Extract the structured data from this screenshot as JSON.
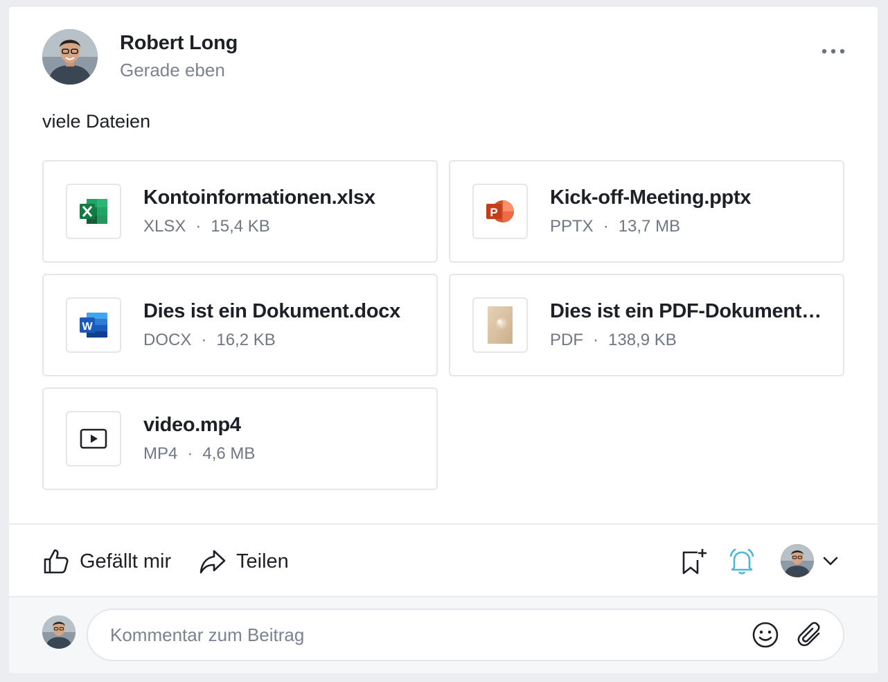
{
  "post": {
    "author": "Robert Long",
    "time": "Gerade eben",
    "text": "viele Dateien"
  },
  "files": [
    {
      "name": "Kontoinformationen.xlsx",
      "type": "XLSX",
      "size": "15,4 KB",
      "icon": "excel-icon"
    },
    {
      "name": "Kick-off-Meeting.pptx",
      "type": "PPTX",
      "size": "13,7 MB",
      "icon": "powerpoint-icon"
    },
    {
      "name": "Dies ist ein Dokument.docx",
      "type": "DOCX",
      "size": "16,2 KB",
      "icon": "word-icon"
    },
    {
      "name": "Dies ist ein PDF-Dokument…",
      "type": "PDF",
      "size": "138,9 KB",
      "icon": "pdf-thumbnail"
    },
    {
      "name": "video.mp4",
      "type": "MP4",
      "size": "4,6 MB",
      "icon": "video-play-icon"
    }
  ],
  "separator": "·",
  "actions": {
    "like_label": "Gefällt mir",
    "share_label": "Teilen"
  },
  "comment": {
    "placeholder": "Kommentar zum Beitrag"
  },
  "colors": {
    "accent_bell": "#4bb8d6",
    "text": "#1d2026",
    "muted": "#7b8391",
    "border": "#e3e6ea"
  }
}
